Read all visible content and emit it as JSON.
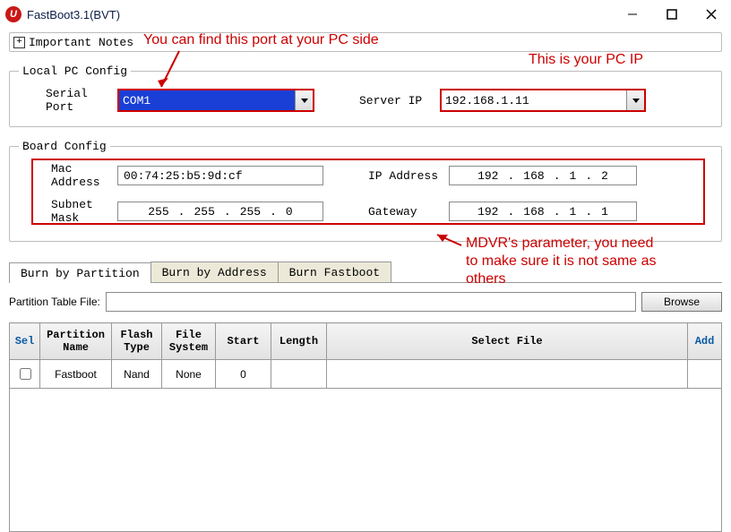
{
  "window": {
    "title": "FastBoot3.1(BVT)",
    "icon_letter": "U"
  },
  "notes_bar": {
    "label": "Important Notes"
  },
  "annotations": {
    "port_hint": "You can find this port at your PC side",
    "ip_hint": "This is your PC IP",
    "mdvr_hint_line1": "MDVR's parameter, you need",
    "mdvr_hint_line2": "to make sure it is not same as",
    "mdvr_hint_line3": "others"
  },
  "local_pc": {
    "legend": "Local PC Config",
    "serial_port_label": "Serial Port",
    "serial_port_value": "COM1",
    "server_ip_label": "Server IP",
    "server_ip_value": "192.168.1.11"
  },
  "board": {
    "legend": "Board Config",
    "mac_label": "Mac Address",
    "mac_value": "00:74:25:b5:9d:cf",
    "ip_label": "IP Address",
    "ip_value": {
      "o1": "192",
      "o2": "168",
      "o3": "1",
      "o4": "2"
    },
    "subnet_label": "Subnet Mask",
    "subnet_value": {
      "o1": "255",
      "o2": "255",
      "o3": "255",
      "o4": "0"
    },
    "gateway_label": "Gateway",
    "gateway_value": {
      "o1": "192",
      "o2": "168",
      "o3": "1",
      "o4": "1"
    }
  },
  "tabs": {
    "t1": "Burn by Partition",
    "t2": "Burn by Address",
    "t3": "Burn Fastboot"
  },
  "ptf": {
    "label": "Partition Table File:",
    "value": "",
    "browse": "Browse"
  },
  "grid": {
    "headers": {
      "sel": "Sel",
      "partition_name": "Partition Name",
      "flash_type": "Flash Type",
      "file_system": "File System",
      "start": "Start",
      "length": "Length",
      "select_file": "Select File",
      "add": "Add"
    },
    "rows": [
      {
        "sel": false,
        "partition_name": "Fastboot",
        "flash_type": "Nand",
        "file_system": "None",
        "start": "0",
        "length": "",
        "select_file": ""
      }
    ]
  }
}
